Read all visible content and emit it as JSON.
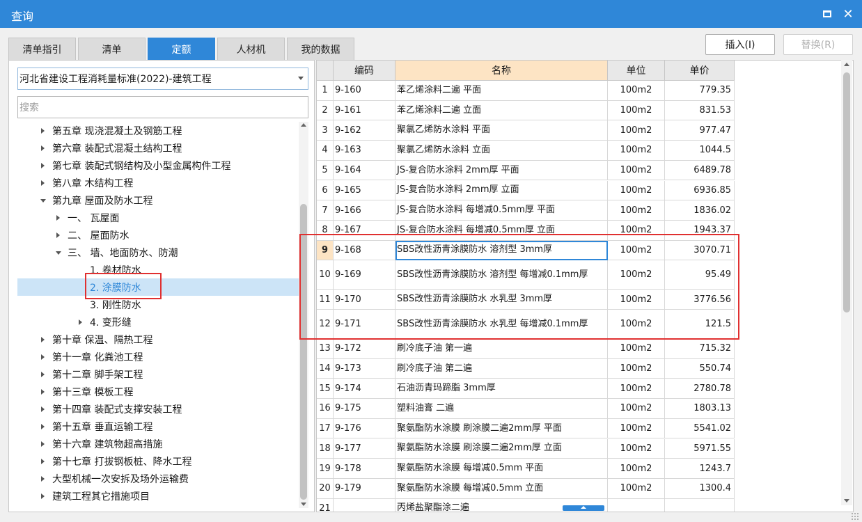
{
  "window": {
    "title": "查询"
  },
  "tabs": [
    {
      "label": "清单指引",
      "active": false
    },
    {
      "label": "清单",
      "active": false
    },
    {
      "label": "定额",
      "active": true
    },
    {
      "label": "人材机",
      "active": false
    },
    {
      "label": "我的数据",
      "active": false
    }
  ],
  "buttons": {
    "insert": "插入(I)",
    "replace": "替换(R)"
  },
  "combo": {
    "value": "河北省建设工程消耗量标准(2022)-建筑工程"
  },
  "search": {
    "placeholder": "搜索"
  },
  "tree": [
    {
      "label": "第五章 现浇混凝土及钢筋工程",
      "level": 0,
      "expander": "collapsed"
    },
    {
      "label": "第六章 装配式混凝土结构工程",
      "level": 0,
      "expander": "collapsed"
    },
    {
      "label": "第七章 装配式钢结构及小型金属构件工程",
      "level": 0,
      "expander": "collapsed"
    },
    {
      "label": "第八章 木结构工程",
      "level": 0,
      "expander": "collapsed"
    },
    {
      "label": "第九章 屋面及防水工程",
      "level": 0,
      "expander": "expanded"
    },
    {
      "label": "一、 瓦屋面",
      "level": 1,
      "expander": "collapsed"
    },
    {
      "label": "二、 屋面防水",
      "level": 1,
      "expander": "collapsed"
    },
    {
      "label": "三、 墙、地面防水、防潮",
      "level": 1,
      "expander": "expanded"
    },
    {
      "label": "1. 卷材防水",
      "level": 2,
      "expander": "none"
    },
    {
      "label": "2. 涂膜防水",
      "level": 2,
      "expander": "none",
      "selected": true
    },
    {
      "label": "3. 刚性防水",
      "level": 2,
      "expander": "none"
    },
    {
      "label": "4. 变形缝",
      "level": 2,
      "expander": "collapsed"
    },
    {
      "label": "第十章 保温、隔热工程",
      "level": 0,
      "expander": "collapsed"
    },
    {
      "label": "第十一章 化粪池工程",
      "level": 0,
      "expander": "collapsed"
    },
    {
      "label": "第十二章 脚手架工程",
      "level": 0,
      "expander": "collapsed"
    },
    {
      "label": "第十三章 模板工程",
      "level": 0,
      "expander": "collapsed"
    },
    {
      "label": "第十四章 装配式支撑安装工程",
      "level": 0,
      "expander": "collapsed"
    },
    {
      "label": "第十五章 垂直运输工程",
      "level": 0,
      "expander": "collapsed"
    },
    {
      "label": "第十六章 建筑物超高措施",
      "level": 0,
      "expander": "collapsed"
    },
    {
      "label": "第十七章 打拔钢板桩、降水工程",
      "level": 0,
      "expander": "collapsed"
    },
    {
      "label": "大型机械一次安拆及场外运输费",
      "level": 0,
      "expander": "collapsed"
    },
    {
      "label": "建筑工程其它措施项目",
      "level": 0,
      "expander": "collapsed"
    }
  ],
  "grid": {
    "columns": [
      "",
      "编码",
      "名称",
      "单位",
      "单价"
    ],
    "rows": [
      {
        "n": "1",
        "code": "9-160",
        "name": "苯乙烯涂料二遍 平面",
        "unit": "100m2",
        "price": "779.35"
      },
      {
        "n": "2",
        "code": "9-161",
        "name": "苯乙烯涂料二遍 立面",
        "unit": "100m2",
        "price": "831.53"
      },
      {
        "n": "3",
        "code": "9-162",
        "name": "聚氯乙烯防水涂料 平面",
        "unit": "100m2",
        "price": "977.47"
      },
      {
        "n": "4",
        "code": "9-163",
        "name": "聚氯乙烯防水涂料 立面",
        "unit": "100m2",
        "price": "1044.5"
      },
      {
        "n": "5",
        "code": "9-164",
        "name": "JS-复合防水涂料 2mm厚 平面",
        "unit": "100m2",
        "price": "6489.78"
      },
      {
        "n": "6",
        "code": "9-165",
        "name": "JS-复合防水涂料 2mm厚 立面",
        "unit": "100m2",
        "price": "6936.85"
      },
      {
        "n": "7",
        "code": "9-166",
        "name": "JS-复合防水涂料 每增减0.5mm厚 平面",
        "unit": "100m2",
        "price": "1836.02"
      },
      {
        "n": "8",
        "code": "9-167",
        "name": "JS-复合防水涂料 每增减0.5mm厚 立面",
        "unit": "100m2",
        "price": "1943.37"
      },
      {
        "n": "9",
        "code": "9-168",
        "name": "SBS改性沥青涂膜防水 溶剂型 3mm厚",
        "unit": "100m2",
        "price": "3070.71",
        "current": true
      },
      {
        "n": "10",
        "code": "9-169",
        "name": "SBS改性沥青涂膜防水 溶剂型 每增减0.1mm厚",
        "unit": "100m2",
        "price": "95.49",
        "tall": true
      },
      {
        "n": "11",
        "code": "9-170",
        "name": "SBS改性沥青涂膜防水 水乳型 3mm厚",
        "unit": "100m2",
        "price": "3776.56"
      },
      {
        "n": "12",
        "code": "9-171",
        "name": "SBS改性沥青涂膜防水 水乳型 每增减0.1mm厚",
        "unit": "100m2",
        "price": "121.5",
        "tall": true
      },
      {
        "n": "13",
        "code": "9-172",
        "name": "刷冷底子油 第一遍",
        "unit": "100m2",
        "price": "715.32"
      },
      {
        "n": "14",
        "code": "9-173",
        "name": "刷冷底子油 第二遍",
        "unit": "100m2",
        "price": "550.74"
      },
      {
        "n": "15",
        "code": "9-174",
        "name": "石油沥青玛蹄脂 3mm厚",
        "unit": "100m2",
        "price": "2780.78"
      },
      {
        "n": "16",
        "code": "9-175",
        "name": "塑料油膏 二遍",
        "unit": "100m2",
        "price": "1803.13"
      },
      {
        "n": "17",
        "code": "9-176",
        "name": "聚氨酯防水涂膜 刷涂膜二遍2mm厚 平面",
        "unit": "100m2",
        "price": "5541.02"
      },
      {
        "n": "18",
        "code": "9-177",
        "name": "聚氨酯防水涂膜 刷涂膜二遍2mm厚 立面",
        "unit": "100m2",
        "price": "5971.55"
      },
      {
        "n": "19",
        "code": "9-178",
        "name": "聚氨酯防水涂膜 每增减0.5mm 平面",
        "unit": "100m2",
        "price": "1243.7"
      },
      {
        "n": "20",
        "code": "9-179",
        "name": "聚氨酯防水涂膜 每增减0.5mm 立面",
        "unit": "100m2",
        "price": "1300.4"
      },
      {
        "n": "21",
        "code": "",
        "name": "丙烯盐聚酯涂二遍",
        "unit": "",
        "price": ""
      }
    ]
  },
  "colors": {
    "accent": "#2f87d8",
    "highlight_box": "#e03030",
    "header_sorted": "#fde4c4"
  }
}
